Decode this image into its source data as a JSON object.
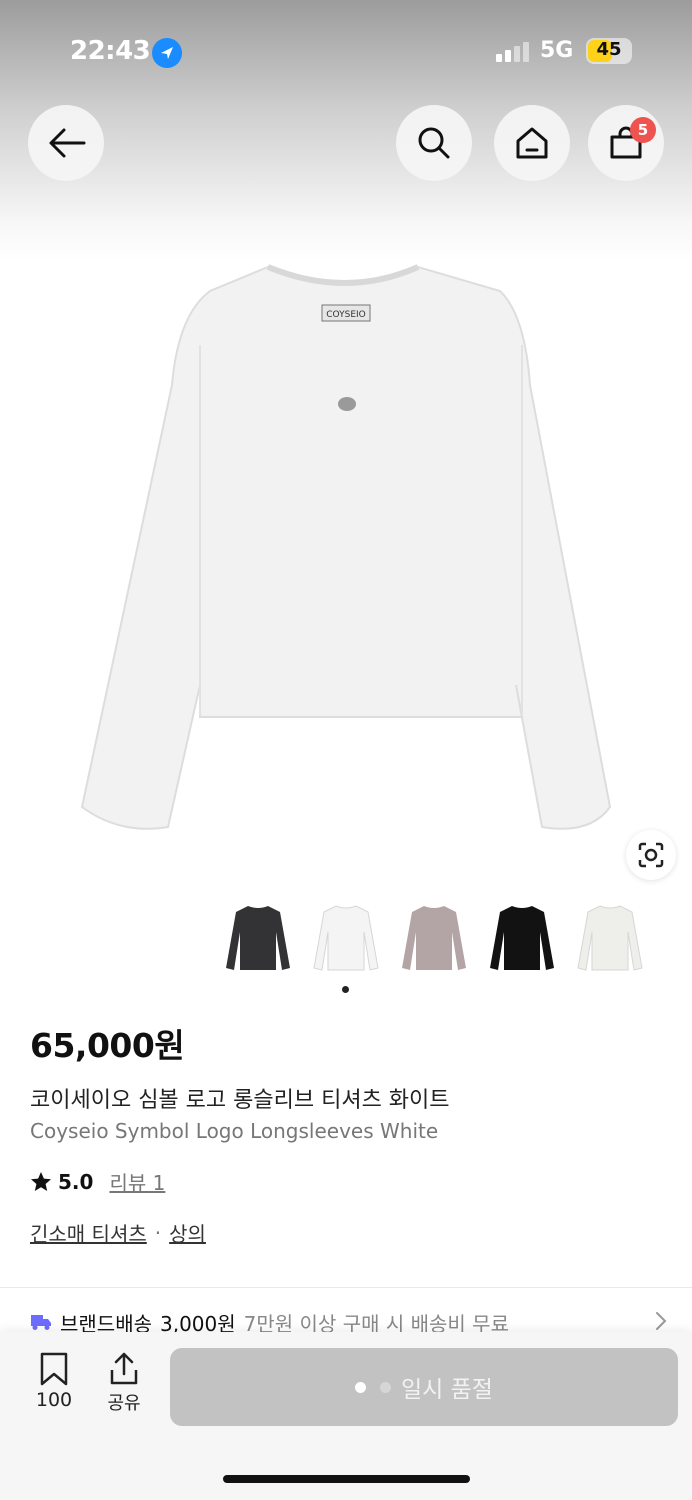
{
  "status_bar": {
    "time": "22:43",
    "network": "5G",
    "battery": "45"
  },
  "header": {
    "back_icon": "back-arrow-icon",
    "search_icon": "search-icon",
    "home_icon": "home-icon",
    "cart_icon": "shopping-bag-icon",
    "cart_badge": "5"
  },
  "product": {
    "image_label": "COYSEIO",
    "variants": [
      {
        "color": "#333336"
      },
      {
        "color": "#f4f4f4"
      },
      {
        "color": "#b3a5a6"
      },
      {
        "color": "#121212"
      },
      {
        "color": "#eeeeea"
      }
    ],
    "price": "65,000원",
    "name_ko": "코이세이오 심볼 로고 롱슬리브 티셔츠 화이트",
    "name_en": "Coyseio Symbol Logo Longsleeves White",
    "rating": "5.0",
    "review_label": "리뷰 1",
    "category": "긴소매 티셔츠",
    "separator": "·",
    "parent_category": "상의"
  },
  "shipping": {
    "label": "브랜드배송",
    "fee": "3,000원",
    "note": "7만원 이상 구매 시 배송비 무료"
  },
  "bottom_bar": {
    "bookmark_count": "100",
    "share_label": "공유",
    "buy_label": "일시 품절"
  },
  "colors": {
    "accent_badge": "#ef5350",
    "disabled_button": "#c2c2c2",
    "shipping_truck": "#6c6cff"
  }
}
